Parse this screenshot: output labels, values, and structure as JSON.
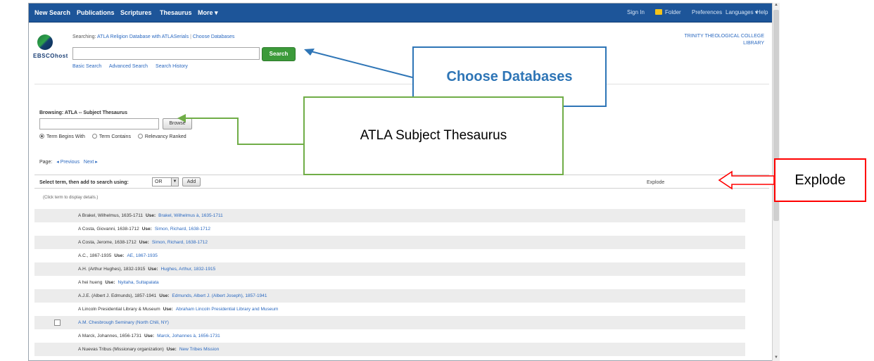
{
  "topnav": {
    "left_items": [
      "New Search",
      "Publications",
      "Scriptures",
      "Thesaurus",
      "More ▾"
    ],
    "right_items": [
      "Sign In",
      "Folder",
      "Preferences",
      "Languages ▾",
      "Help"
    ]
  },
  "header": {
    "logo_text": "EBSCOhost",
    "searching_label": "Searching:",
    "database_name": "ATLA Religion Database with ATLASerials",
    "choose_databases_link": "Choose Databases",
    "search_value": "",
    "search_button": "Search",
    "sublinks": [
      "Basic Search",
      "Advanced Search",
      "Search History"
    ],
    "library_name": "TRINITY THEOLOGICAL COLLEGE LIBRARY"
  },
  "browse": {
    "browsing_label": "Browsing: ATLA -- Subject Thesaurus",
    "input_value": "",
    "browse_button": "Browse",
    "radio_options": [
      {
        "label": "Term Begins With",
        "selected": true
      },
      {
        "label": "Term Contains",
        "selected": false
      },
      {
        "label": "Relevancy Ranked",
        "selected": false
      }
    ],
    "page_label": "Page:",
    "prev_link": "◂ Previous",
    "next_link": "Next ▸"
  },
  "select_bar": {
    "label": "Select term, then add to search using:",
    "operator": "OR",
    "add_button": "Add",
    "explode_header": "Explode"
  },
  "click_hint": "(Click term to display details.)",
  "terms": [
    {
      "term": "A Brakel, Wilhelmus, 1635-1711",
      "use": "Use:",
      "target": "Brakel, Wilhelmus à, 1635-1711",
      "checkbox": false
    },
    {
      "term": "A Costa, Giovanni, 1638-1712",
      "use": "Use:",
      "target": "Simon, Richard, 1638-1712",
      "checkbox": false
    },
    {
      "term": "A Costa, Jerome, 1638-1712",
      "use": "Use:",
      "target": "Simon, Richard, 1638-1712",
      "checkbox": false
    },
    {
      "term": "A.C., 1867-1935",
      "use": "Use:",
      "target": "AE, 1867-1935",
      "checkbox": false
    },
    {
      "term": "A.H. (Arthur Hughes), 1832-1915",
      "use": "Use:",
      "target": "Hughes, Arthur, 1832-1915",
      "checkbox": false
    },
    {
      "term": "A hei hueng",
      "use": "Use:",
      "target": "Nyitaha, Sultapalata",
      "checkbox": false
    },
    {
      "term": "A.J.E. (Albert J. Edmunds), 1857-1941",
      "use": "Use:",
      "target": "Edmunds, Albert J. (Albert Joseph), 1857-1941",
      "checkbox": false
    },
    {
      "term": "A Lincoln Presidential Library & Museum",
      "use": "Use:",
      "target": "Abraham Lincoln Presidential Library and Museum",
      "checkbox": false
    },
    {
      "term": "A.M. Chesbrough Seminary (North Chili, NY)",
      "use": "",
      "target": "",
      "checkbox": true
    },
    {
      "term": "A Marck, Johannes, 1656-1731",
      "use": "Use:",
      "target": "Marck, Johannes à, 1656-1731",
      "checkbox": false
    },
    {
      "term": "A Nuevas Tribus (Missionary organization)",
      "use": "Use:",
      "target": "New Tribes Mission",
      "checkbox": false
    }
  ],
  "callouts": {
    "choose_databases": "Choose Databases",
    "atla_thesaurus": "ATLA Subject Thesaurus",
    "explode": "Explode"
  },
  "colors": {
    "nav_blue": "#1d5599",
    "search_green": "#3c9a3a",
    "link_blue": "#2b69c0",
    "callout_blue": "#2e75b6",
    "callout_green": "#70ad47",
    "callout_red": "#ff0000"
  }
}
